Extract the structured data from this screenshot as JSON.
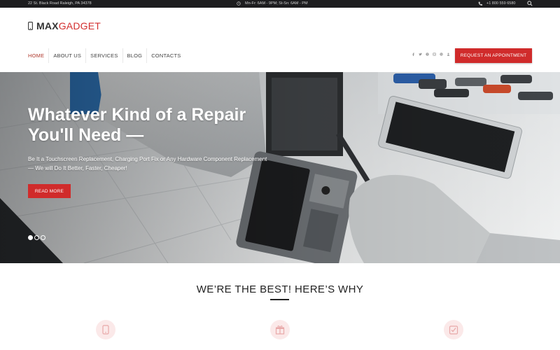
{
  "topbar": {
    "address": "22 St. Black Road Raleigh, PA 34378",
    "hours": "Mn-Fr: 6AM - 9PM; St-Sn: 6AM - PM",
    "phone": "+1 800 559 6580"
  },
  "brand": {
    "logo_bold": "MAX",
    "logo_rest": "GADGET",
    "accent": "#d02b2b"
  },
  "nav": {
    "items": [
      {
        "label": "HOME",
        "active": true
      },
      {
        "label": "ABOUT US"
      },
      {
        "label": "SERVICES"
      },
      {
        "label": "BLOG"
      },
      {
        "label": "CONTACTS"
      }
    ],
    "socials": [
      "facebook-icon",
      "twitter-icon",
      "pinterest-icon",
      "instagram-icon",
      "google-icon",
      "person-icon"
    ],
    "cta_label": "REQUEST AN APPOINTMENT"
  },
  "hero": {
    "title_line1": "Whatever Kind of a Repair",
    "title_line2": "You'll Need —",
    "subtitle_line1": "Be It a Touchscreen Replacement, Charging Port Fix or Any Hardware Component Replacement",
    "subtitle_line2": "— We will Do It Better, Faster, Cheaper!",
    "button_label": "READ MORE",
    "slides": 3,
    "active_slide": 1
  },
  "section": {
    "title": "WE’RE THE BEST! HERE’S WHY",
    "features": [
      "phone-icon",
      "gift-icon",
      "check-icon"
    ]
  }
}
